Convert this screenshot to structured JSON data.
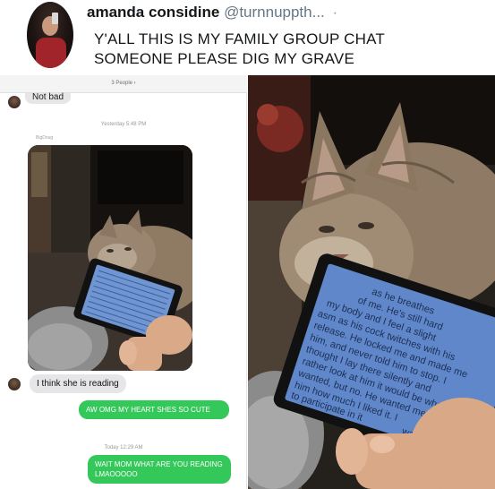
{
  "tweet": {
    "display_name": "amanda considine",
    "handle": "@turnnuppth...",
    "separator": "·",
    "text_line1": "Y'ALL THIS IS MY FAMILY GROUP CHAT",
    "text_line2": "SOMEONE PLEASE DIG MY GRAVE"
  },
  "chat": {
    "header": "3 People ›",
    "previous_message": "Not bad",
    "timestamp_1": "Yesterday 5:48 PM",
    "sender_name": "BigDoug",
    "incoming_message": "I think she is reading",
    "outgoing_1": "AW OMG MY HEART SHES SO CUTE",
    "timestamp_2": "Today 12:29 AM",
    "outgoing_2": "WAIT MOM WHAT ARE YOU READING LMAOOOOO"
  },
  "tablet_text": {
    "lines": [
      "as he breathes",
      "of me. He's still hard",
      "my body and I feel a slight",
      "asm as his cock twitches with his",
      "release. He locked me and made me",
      "him, and never told him to stop. I",
      "thought I lay there silently and",
      "rather look at him it would be what he",
      "wanted, but no. He wanted me to tell",
      "him how much I liked it. I",
      "to participate in it",
      "wanted"
    ]
  },
  "colors": {
    "sms_green": "#34c759",
    "incoming_gray": "#e6e6e8",
    "tablet_screen": "#5f87c9"
  }
}
